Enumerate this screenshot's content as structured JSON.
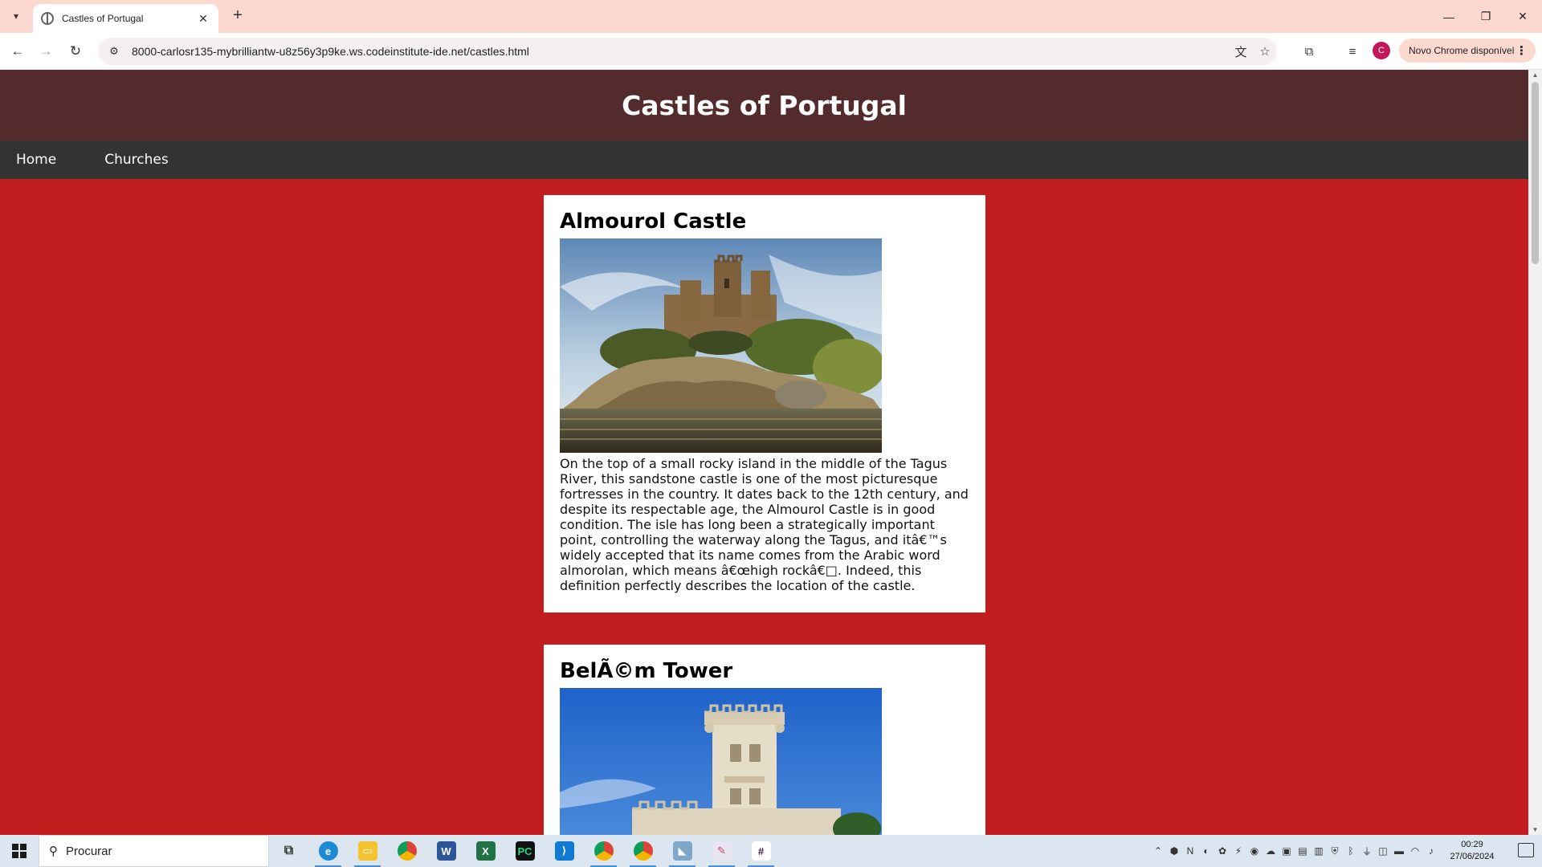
{
  "browser": {
    "tab_title": "Castles of Portugal",
    "url": "8000-carlosr135-mybrilliantw-u8z56y3p9ke.ws.codeinstitute-ide.net/castles.html",
    "profile_initial": "C",
    "update_label": "Novo Chrome disponível"
  },
  "page": {
    "site_title": "Castles of Portugal",
    "nav": [
      {
        "label": "Home"
      },
      {
        "label": "Churches"
      }
    ],
    "castles": [
      {
        "name": "Almourol Castle",
        "description": "On the top of a small rocky island in the middle of the Tagus River, this sandstone castle is one of the most picturesque fortresses in the country. It dates back to the 12th century, and despite its respectable age, the Almourol Castle is in good condition. The isle has long been a strategically important point, controlling the waterway along the Tagus, and itâ€™s widely accepted that its name comes from the Arabic word almorolan, which means â€œhigh rockâ€□. Indeed, this definition perfectly describes the location of the castle."
      },
      {
        "name": "BelÃ©m Tower"
      }
    ]
  },
  "taskbar": {
    "search_placeholder": "Procurar",
    "time": "00:29",
    "date": "27/06/2024",
    "apps": [
      "task-view",
      "edge",
      "file-explorer",
      "chrome",
      "word",
      "excel",
      "pycharm",
      "vscode",
      "chrome-profile-1",
      "chrome-profile-2",
      "app-generic",
      "paint",
      "slack"
    ]
  },
  "colors": {
    "page_background": "#c11d1e",
    "header_background": "#532b2d",
    "nav_background": "#333333",
    "tabstrip": "#fcd9cf"
  }
}
